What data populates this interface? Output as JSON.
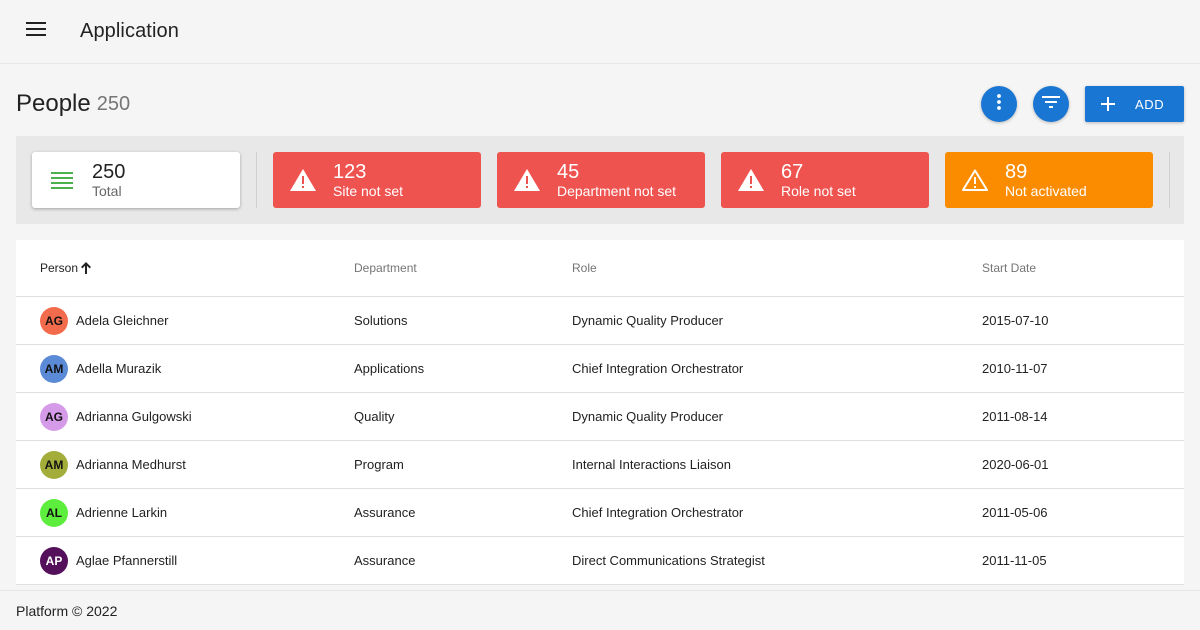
{
  "app": {
    "title": "Application",
    "menu_icon": "menu-icon"
  },
  "page": {
    "title": "People",
    "count": "250"
  },
  "actions": {
    "more_icon": "more-vert-icon",
    "filter_icon": "filter-icon",
    "add_label": "ADD",
    "add_icon": "plus-icon",
    "accent_color": "#1976d2"
  },
  "stats": {
    "total": {
      "value": "250",
      "label": "Total",
      "icon": "list-icon",
      "icon_color": "#4caf50"
    },
    "site": {
      "value": "123",
      "label": "Site not set",
      "icon": "warning-icon",
      "color": "#ef5350"
    },
    "department": {
      "value": "45",
      "label": "Department not set",
      "icon": "warning-icon",
      "color": "#ef5350"
    },
    "role": {
      "value": "67",
      "label": "Role not set",
      "icon": "warning-icon",
      "color": "#ef5350"
    },
    "activated": {
      "value": "89",
      "label": "Not activated",
      "icon": "warning-outline-icon",
      "color": "#fb8c00"
    }
  },
  "table": {
    "columns": {
      "person": "Person",
      "department": "Department",
      "role": "Role",
      "start_date": "Start Date"
    },
    "sort_icon": "arrow-up-icon",
    "rows": [
      {
        "initials": "AG",
        "name": "Adela Gleichner",
        "department": "Solutions",
        "role": "Dynamic Quality Producer",
        "start_date": "2015-07-10",
        "avatar_color": "#f26b4d"
      },
      {
        "initials": "AM",
        "name": "Adella Murazik",
        "department": "Applications",
        "role": "Chief Integration Orchestrator",
        "start_date": "2010-11-07",
        "avatar_color": "#5b8ad6"
      },
      {
        "initials": "AG",
        "name": "Adrianna Gulgowski",
        "department": "Quality",
        "role": "Dynamic Quality Producer",
        "start_date": "2011-08-14",
        "avatar_color": "#d59be8"
      },
      {
        "initials": "AM",
        "name": "Adrianna Medhurst",
        "department": "Program",
        "role": "Internal Interactions Liaison",
        "start_date": "2020-06-01",
        "avatar_color": "#a2ad3a"
      },
      {
        "initials": "AL",
        "name": "Adrienne Larkin",
        "department": "Assurance",
        "role": "Chief Integration Orchestrator",
        "start_date": "2011-05-06",
        "avatar_color": "#5ded3c"
      },
      {
        "initials": "AP",
        "name": "Aglae Pfannerstill",
        "department": "Assurance",
        "role": "Direct Communications Strategist",
        "start_date": "2011-11-05",
        "avatar_color": "#54105a"
      }
    ]
  },
  "footer": {
    "text": "Platform © 2022"
  }
}
